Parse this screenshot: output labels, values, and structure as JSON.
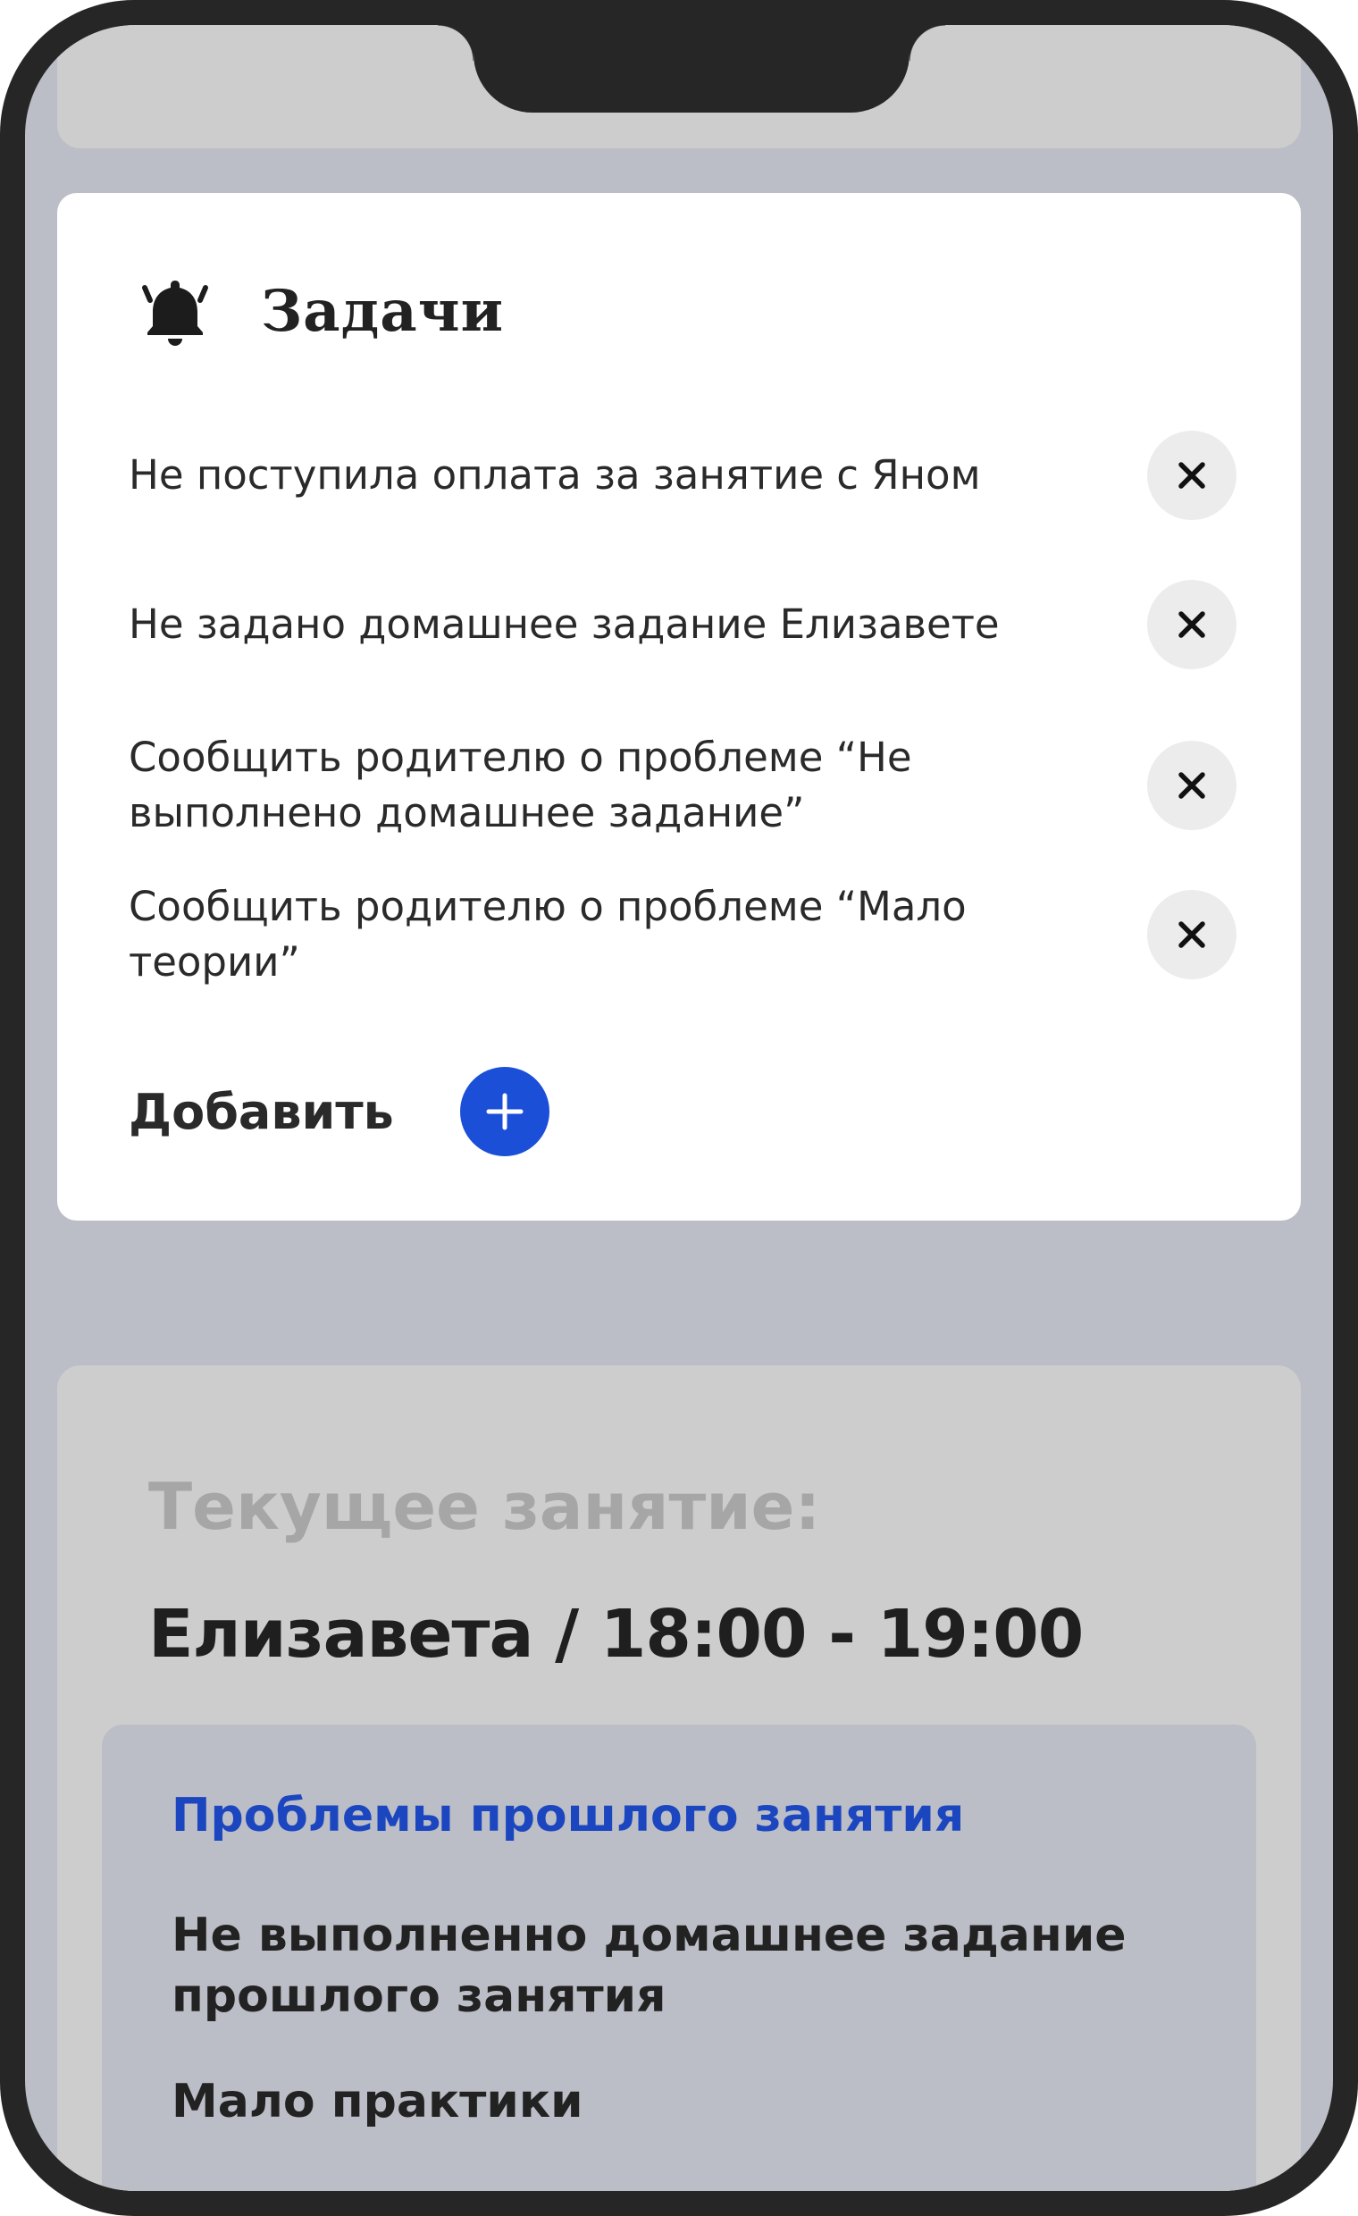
{
  "tasks": {
    "title": "Задачи",
    "header_icon": "bell-icon",
    "items": [
      {
        "text": "Не поступила оплата за занятие с Яном",
        "action_icon": "close-icon"
      },
      {
        "text": "Не задано домашнее задание Елизавете",
        "action_icon": "close-icon"
      },
      {
        "text": "Сообщить родителю о проблеме “Не выполнено домашнее задание”",
        "action_icon": "close-icon"
      },
      {
        "text": "Сообщить родителю о проблеме “Мало теории”",
        "action_icon": "close-icon"
      }
    ],
    "add_label": "Добавить",
    "add_icon": "plus-icon"
  },
  "current_lesson": {
    "label": "Текущее занятие:",
    "value": "Елизавета / 18:00 - 19:00",
    "problems": {
      "title": "Проблемы прошлого занятия",
      "items": [
        "Не выполненно домашнее задание прошлого занятия",
        "Мало практики"
      ]
    }
  },
  "colors": {
    "accent": "#1b4fd8",
    "problems_title": "#1b46c0",
    "screen_background": "#bbbec6",
    "card_background": "#ffffff",
    "lesson_card_background": "#cdcdcd",
    "phone_frame": "#262626"
  }
}
